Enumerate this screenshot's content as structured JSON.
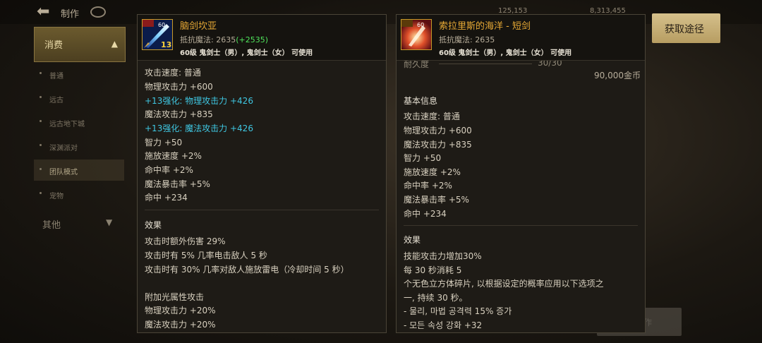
{
  "topbar": {
    "title": "制作",
    "currency_1": "125,153",
    "currency_2": "8,313,455"
  },
  "sidebar": {
    "category": "消费",
    "items": [
      "普通",
      "远古",
      "远古地下城",
      "深渊派对",
      "团队模式",
      "宠物"
    ],
    "active_index": 4,
    "other": "其他"
  },
  "left_item": {
    "name": "脑剑坎亚",
    "resist_label": "抵抗魔法: 2635",
    "resist_bonus": "(+2535)",
    "requirement": "60级 鬼剑士（男）, 鬼剑士（女） 可使用",
    "icon_level": "60",
    "icon_enhance": "13",
    "stats": [
      {
        "text": "攻击速度: 普通",
        "style": "normal"
      },
      {
        "text": "物理攻击力 +600",
        "style": "normal"
      },
      {
        "text": "+13强化: 物理攻击力 +426",
        "style": "cyan"
      },
      {
        "text": "魔法攻击力 +835",
        "style": "normal"
      },
      {
        "text": "+13强化: 魔法攻击力 +426",
        "style": "cyan"
      },
      {
        "text": "智力 +50",
        "style": "normal"
      },
      {
        "text": "施放速度 +2%",
        "style": "normal"
      },
      {
        "text": "命中率 +2%",
        "style": "normal"
      },
      {
        "text": "魔法暴击率 +5%",
        "style": "normal"
      },
      {
        "text": "命中 +234",
        "style": "normal"
      }
    ],
    "effect_title": "效果",
    "effects": [
      "攻击时额外伤害 29%",
      "攻击时有 5% 几率电击敌人 5 秒",
      "攻击时有 30% 几率对敌人施放雷电（冷却时间 5 秒）",
      "",
      "附加光属性攻击",
      "物理攻击力 +20%",
      "魔法攻击力 +20%"
    ]
  },
  "right_item": {
    "name": "索拉里斯的海洋 - 短剑",
    "resist_label": "抵抗魔法: 2635",
    "requirement": "60级 鬼剑士（男）, 鬼剑士（女） 可使用",
    "icon_level": "60",
    "durability_label": "耐久度",
    "durability_value": "30/30",
    "price": "90,000金币",
    "basic_title": "基本信息",
    "stats": [
      "攻击速度: 普通",
      "物理攻击力 +600",
      "魔法攻击力 +835",
      "智力 +50",
      "施放速度 +2%",
      "命中率 +2%",
      "魔法暴击率 +5%",
      "命中 +234"
    ],
    "effect_title": "效果",
    "effects": [
      "技能攻击力增加30%",
      "每 30 秒消耗 5",
      "个无色立方体碎片, 以根据设定的概率应用以下选项之",
      "一, 持续 30 秒。",
      " - 물리, 마법 공격력 15% 증가",
      " - 모든 속성 강화 +32"
    ]
  },
  "buttons": {
    "get_path": "获取途径"
  },
  "colors": {
    "item_name": "#e7a935",
    "bonus": "#4fe35b",
    "enhance": "#3fc7e2",
    "button": "#c9b27a"
  }
}
